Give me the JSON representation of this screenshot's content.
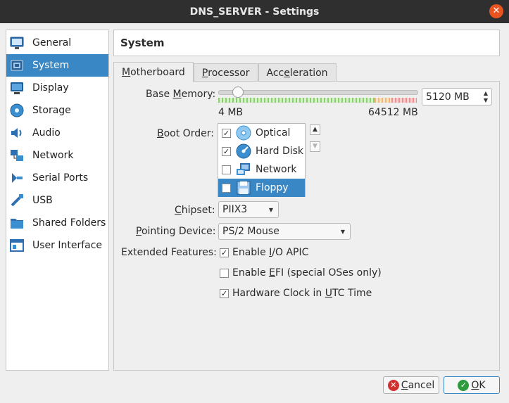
{
  "window": {
    "title": "DNS_SERVER - Settings",
    "close_glyph": "✕"
  },
  "sidebar": {
    "items": [
      {
        "label": "General",
        "icon": "general-icon"
      },
      {
        "label": "System",
        "icon": "system-icon",
        "selected": true
      },
      {
        "label": "Display",
        "icon": "display-icon"
      },
      {
        "label": "Storage",
        "icon": "storage-icon"
      },
      {
        "label": "Audio",
        "icon": "audio-icon"
      },
      {
        "label": "Network",
        "icon": "network-icon"
      },
      {
        "label": "Serial Ports",
        "icon": "serial-ports-icon"
      },
      {
        "label": "USB",
        "icon": "usb-icon"
      },
      {
        "label": "Shared Folders",
        "icon": "shared-folders-icon"
      },
      {
        "label": "User Interface",
        "icon": "user-interface-icon"
      }
    ]
  },
  "page": {
    "title": "System"
  },
  "tabs": [
    {
      "pre": "",
      "u": "M",
      "post": "otherboard",
      "active": true
    },
    {
      "pre": "",
      "u": "P",
      "post": "rocessor"
    },
    {
      "pre": "Acc",
      "u": "e",
      "post": "leration"
    }
  ],
  "motherboard": {
    "base_memory": {
      "label_pre": "Base ",
      "label_u": "M",
      "label_post": "emory:",
      "min_label": "4 MB",
      "max_label": "64512 MB",
      "value": "5120 MB",
      "min": 4,
      "max": 64512,
      "current": 5120
    },
    "boot_order": {
      "label_pre": "",
      "label_u": "B",
      "label_post": "oot Order:",
      "items": [
        {
          "label": "Optical",
          "checked": true,
          "icon": "optical-disc-icon"
        },
        {
          "label": "Hard Disk",
          "checked": true,
          "icon": "hard-disk-icon"
        },
        {
          "label": "Network",
          "checked": false,
          "icon": "network-boot-icon"
        },
        {
          "label": "Floppy",
          "checked": false,
          "icon": "floppy-icon",
          "selected": true
        }
      ],
      "up_glyph": "▲",
      "down_glyph": "▼"
    },
    "chipset": {
      "label_pre": "",
      "label_u": "C",
      "label_post": "hipset:",
      "value": "PIIX3"
    },
    "pointing_device": {
      "label_pre": "",
      "label_u": "P",
      "label_post": "ointing Device:",
      "value": "PS/2 Mouse"
    },
    "extended_features": {
      "label": "Extended Features:",
      "items": [
        {
          "pre": "Enable ",
          "u": "I",
          "post": "/O APIC",
          "checked": true
        },
        {
          "pre": "Enable ",
          "u": "E",
          "post": "FI (special OSes only)",
          "checked": false
        },
        {
          "pre": "Hardware Clock in ",
          "u": "U",
          "post": "TC Time",
          "checked": true
        }
      ]
    }
  },
  "buttons": {
    "cancel": {
      "pre": "",
      "u": "C",
      "post": "ancel",
      "glyph": "✕"
    },
    "ok": {
      "pre": "",
      "u": "O",
      "post": "K",
      "glyph": "✓"
    }
  },
  "colors": {
    "selection": "#3a87c5",
    "titlebar": "#2f2f2f",
    "close": "#e95420",
    "cancel_icon": "#d03030",
    "ok_icon": "#2e9c3e"
  }
}
